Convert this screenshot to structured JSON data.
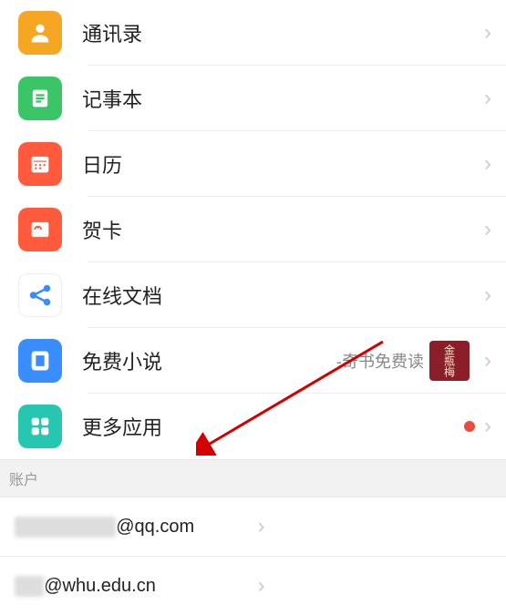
{
  "menu": {
    "items": [
      {
        "label": "通讯录",
        "icon_color": "#f5a623",
        "icon": "contacts"
      },
      {
        "label": "记事本",
        "icon_color": "#3ac569",
        "icon": "note"
      },
      {
        "label": "日历",
        "icon_color": "#ff5a3c",
        "icon": "calendar"
      },
      {
        "label": "贺卡",
        "icon_color": "#ff5a3c",
        "icon": "card"
      },
      {
        "label": "在线文档",
        "icon_color": "#3a8dff",
        "icon": "share"
      },
      {
        "label": "免费小说",
        "icon_color": "#3a8dff",
        "icon": "book",
        "promo_text": "-奇书免费读",
        "thumb_text": "金瓶梅"
      },
      {
        "label": "更多应用",
        "icon_color": "#26c6b0",
        "icon": "grid",
        "has_dot": true
      }
    ]
  },
  "section_header": "账户",
  "accounts": [
    {
      "masked_prefix": "1234567890",
      "suffix": "@qq.com"
    },
    {
      "masked_prefix": "abc",
      "suffix": "@whu.edu.cn"
    }
  ]
}
